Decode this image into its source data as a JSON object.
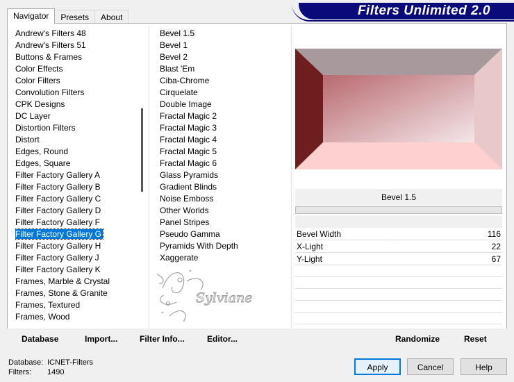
{
  "tabs": [
    {
      "label": "Navigator"
    },
    {
      "label": "Presets"
    },
    {
      "label": "About"
    }
  ],
  "banner": {
    "title": "Filters Unlimited 2.0"
  },
  "categories": {
    "items": [
      "Andrew's Filters 48",
      "Andrew's Filters 51",
      "Buttons & Frames",
      "Color Effects",
      "Color Filters",
      "Convolution Filters",
      "CPK Designs",
      "DC Layer",
      "Distortion Filters",
      "Distort",
      "Edges, Round",
      "Edges, Square",
      "Filter Factory Gallery A",
      "Filter Factory Gallery B",
      "Filter Factory Gallery C",
      "Filter Factory Gallery D",
      "Filter Factory Gallery F",
      "Filter Factory Gallery G",
      "Filter Factory Gallery H",
      "Filter Factory Gallery J",
      "Filter Factory Gallery K",
      "Frames, Marble & Crystal",
      "Frames, Stone & Granite",
      "Frames, Textured",
      "Frames, Wood"
    ],
    "selected": "Filter Factory Gallery G"
  },
  "filters": {
    "items": [
      "Bevel 1.5",
      "Bevel 1",
      "Bevel 2",
      "Blast 'Em",
      "Ciba-Chrome",
      "Cirquelate",
      "Double Image",
      "Fractal Magic 2",
      "Fractal Magic 3",
      "Fractal Magic 4",
      "Fractal Magic 5",
      "Fractal Magic 6",
      "Glass Pyramids",
      "Gradient Blinds",
      "Noise Emboss",
      "Other Worlds",
      "Panel Stripes",
      "Pseudo Gamma",
      "Pyramids With Depth",
      "Xaggerate"
    ],
    "current": "Bevel 1.5"
  },
  "watermark": {
    "text": "Sylviane"
  },
  "preview": {
    "filter_name": "Bevel 1.5",
    "progress": 0,
    "colors": {
      "top": "#a89a9c",
      "left": "#6e1e1e",
      "right": "#e8c8c8",
      "bottom": "#ffd0d0",
      "center_from": "#b86a70",
      "center_to": "#f4e6e8"
    }
  },
  "parameters": [
    {
      "name": "Bevel Width",
      "value": "116",
      "level": 116
    },
    {
      "name": "X-Light",
      "value": "22",
      "level": 22
    },
    {
      "name": "Y-Light",
      "value": "67",
      "level": 67
    }
  ],
  "toolbar": {
    "database": "Database",
    "import": "Import...",
    "filter_info": "Filter Info...",
    "editor": "Editor...",
    "randomize": "Randomize",
    "reset": "Reset"
  },
  "status": {
    "database_label": "Database:",
    "database_value": "ICNET-Filters",
    "filters_label": "Filters:",
    "filters_value": "1490"
  },
  "buttons": {
    "apply": "Apply",
    "cancel": "Cancel",
    "help": "Help"
  }
}
